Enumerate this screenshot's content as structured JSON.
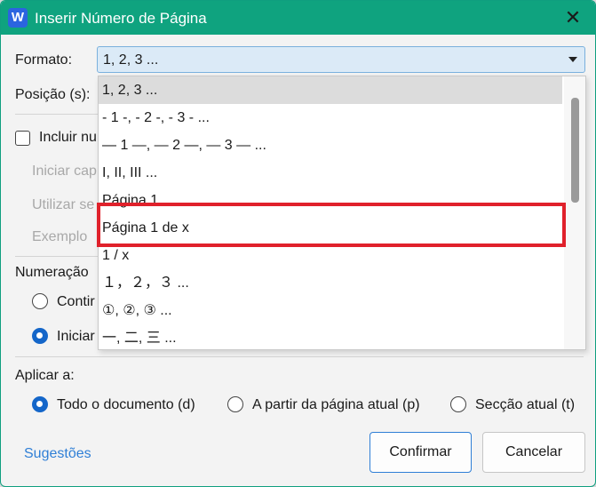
{
  "window": {
    "app_icon_letter": "W",
    "title": "Inserir Número de Página",
    "close_glyph": "✕"
  },
  "format": {
    "label": "Formato:",
    "selected": "1, 2, 3 ...",
    "options": [
      "1, 2, 3 ...",
      "- 1 -, - 2 -, - 3 - ...",
      "— 1 —, — 2 —, — 3 — ...",
      "I, II, III ...",
      "Página 1",
      "Página 1 de x",
      "1 / x",
      "１，２，３ ...",
      "①, ②, ③ ...",
      "一, 二, 三 ..."
    ]
  },
  "position": {
    "label": "Posição (s):"
  },
  "include": {
    "label": "Incluir nu"
  },
  "disabled": {
    "start": "Iniciar cap",
    "use": "Utilizar se",
    "example": "Exemplo"
  },
  "numbering": {
    "label": "Numeração",
    "continue": "Contir",
    "start": "Iniciar"
  },
  "apply": {
    "label": "Aplicar a:",
    "whole_doc": "Todo o documento (d)",
    "from_current": "A partir da página atual (p)",
    "current_section": "Secção atual (t)"
  },
  "footer": {
    "suggestions": "Sugestões",
    "confirm": "Confirmar",
    "cancel": "Cancelar"
  },
  "colors": {
    "title_bar": "#0fa37f",
    "highlight": "#e0212b",
    "accent": "#1466c9"
  }
}
